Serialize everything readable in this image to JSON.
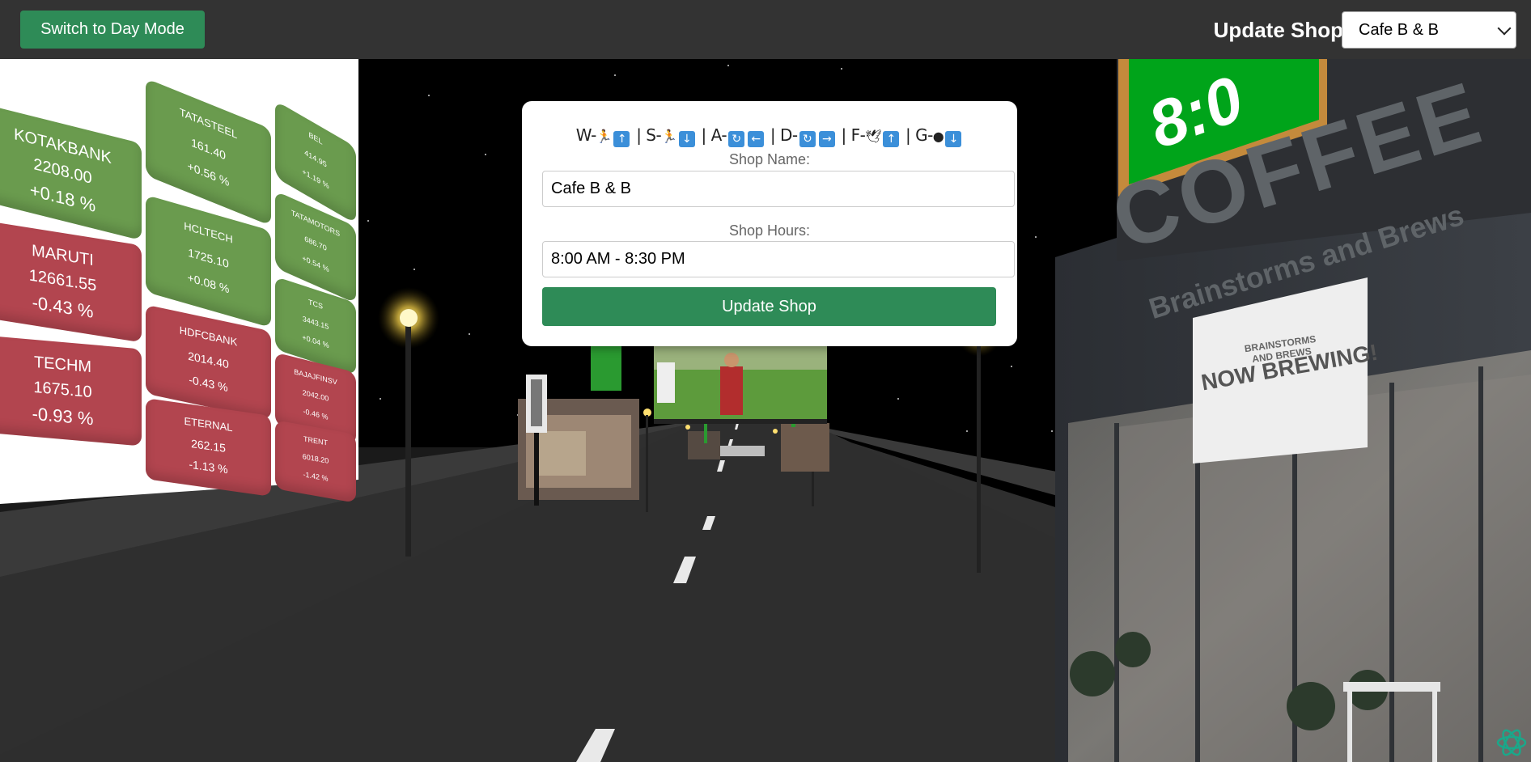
{
  "topbar": {
    "mode_button": "Switch to Day Mode",
    "update_title": "Update Shop",
    "shop_select": "Cafe B & B"
  },
  "dialog": {
    "controls": {
      "w": "W-",
      "s": "| S-",
      "a": "| A-",
      "d": "| D-",
      "f": "| F-",
      "g": "| G-"
    },
    "shop_name_label": "Shop Name:",
    "shop_name_value": "Cafe B & B",
    "shop_hours_label": "Shop Hours:",
    "shop_hours_value": "8:00 AM - 8:30 PM",
    "submit_label": "Update Shop"
  },
  "scene": {
    "stock_board": {
      "tiles": [
        {
          "symbol": "KOTAKBANK",
          "price": "2208.00",
          "change": "+0.18 %",
          "status": "up"
        },
        {
          "symbol": "MARUTI",
          "price": "12661.55",
          "change": "-0.43 %",
          "status": "down"
        },
        {
          "symbol": "TECHM",
          "price": "1675.10",
          "change": "-0.93 %",
          "status": "down"
        },
        {
          "symbol": "TATASTEEL",
          "price": "161.40",
          "change": "+0.56 %",
          "status": "up"
        },
        {
          "symbol": "HCLTECH",
          "price": "1725.10",
          "change": "+0.08 %",
          "status": "up"
        },
        {
          "symbol": "HDFCBANK",
          "price": "2014.40",
          "change": "-0.43 %",
          "status": "down"
        },
        {
          "symbol": "ETERNAL",
          "price": "262.15",
          "change": "-1.13 %",
          "status": "down"
        },
        {
          "symbol": "BEL",
          "price": "414.95",
          "change": "+1.19 %",
          "status": "up"
        },
        {
          "symbol": "TATAMOTORS",
          "price": "686.70",
          "change": "+0.54 %",
          "status": "up"
        },
        {
          "symbol": "TCS",
          "price": "3443.15",
          "change": "+0.04 %",
          "status": "up"
        },
        {
          "symbol": "BAJAJFINSV",
          "price": "2042.00",
          "change": "-0.46 %",
          "status": "down"
        },
        {
          "symbol": "TRENT",
          "price": "6018.20",
          "change": "-1.42 %",
          "status": "down"
        }
      ]
    },
    "cafe": {
      "sign_text": "COFFEE",
      "subtitle": "Brainstorms and Brews",
      "banner_title": "NOW BREWING!",
      "banner_brand": "BRAINSTORMS AND BREWS",
      "clock_text": "8:0"
    }
  },
  "colors": {
    "topbar_bg": "#333333",
    "accent_green": "#2e8b57",
    "stock_up": "#6a9b4e",
    "stock_down": "#b2454f"
  }
}
